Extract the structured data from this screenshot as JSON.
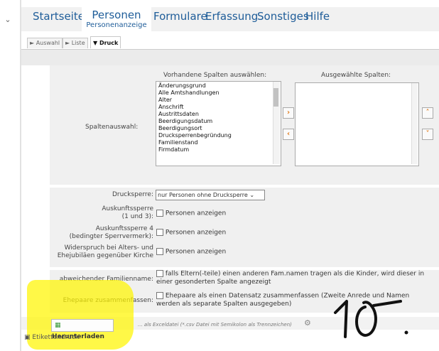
{
  "menu": {
    "items": [
      "Startseite",
      "Personen",
      "Formulare",
      "Erfassung",
      "Sonstiges",
      "Hilfe"
    ],
    "active_sub": "Personenanzeige"
  },
  "tabs": [
    "Auswahl",
    "Liste",
    "Druck"
  ],
  "columns": {
    "label": "Spaltenauswahl:",
    "available_header": "Vorhandene Spalten auswählen:",
    "selected_header": "Ausgewählte Spalten:",
    "available": [
      "Änderungsgrund",
      "Alle Amtshandlungen",
      "Alter",
      "Anschrift",
      "Austrittsdaten",
      "Beerdigungsdatum",
      "Beerdigungsort",
      "Drucksperrenbegründung",
      "Familienstand",
      "Firmdatum"
    ]
  },
  "filters": {
    "drucksperre_label": "Drucksperre:",
    "drucksperre_value": "nur Personen ohne Drucksperre",
    "auskunft13_label_1": "Auskunftssperre",
    "auskunft13_label_2": "(1 und 3):",
    "auskunft4_label_1": "Auskunftssperre 4",
    "auskunft4_label_2": "(bedingter Sperrvermerk):",
    "widerspruch_label_1": "Widerspruch bei Alters- und",
    "widerspruch_label_2": "Ehejubiläen gegenüber Kirche",
    "show_persons": "Personen anzeigen"
  },
  "options": {
    "familienname_label": "abweichender Familienname:",
    "familienname_text_1": "falls Eltern(-teile) einen anderen Fam.namen tragen als die Kinder, wird dieser in",
    "familienname_text_2": "einer gesonderten Spalte angezeigt",
    "ehepaare_label": "Ehepaare zusammenfassen:",
    "ehepaare_text_1": "Ehepaare als einen Datensatz zusammenfassen (Zweite Anrede und Namen",
    "ehepaare_text_2": "werden als separate Spalten ausgegeben)"
  },
  "download": {
    "button_label": "Herunterladen",
    "hint": "... als Exceldatei (*.csv Datei mit Semikolon als Trennzeichen)"
  },
  "etikettendruck": "Etikettendruck",
  "handwriting": "10.",
  "highlight_color": "#fff200"
}
